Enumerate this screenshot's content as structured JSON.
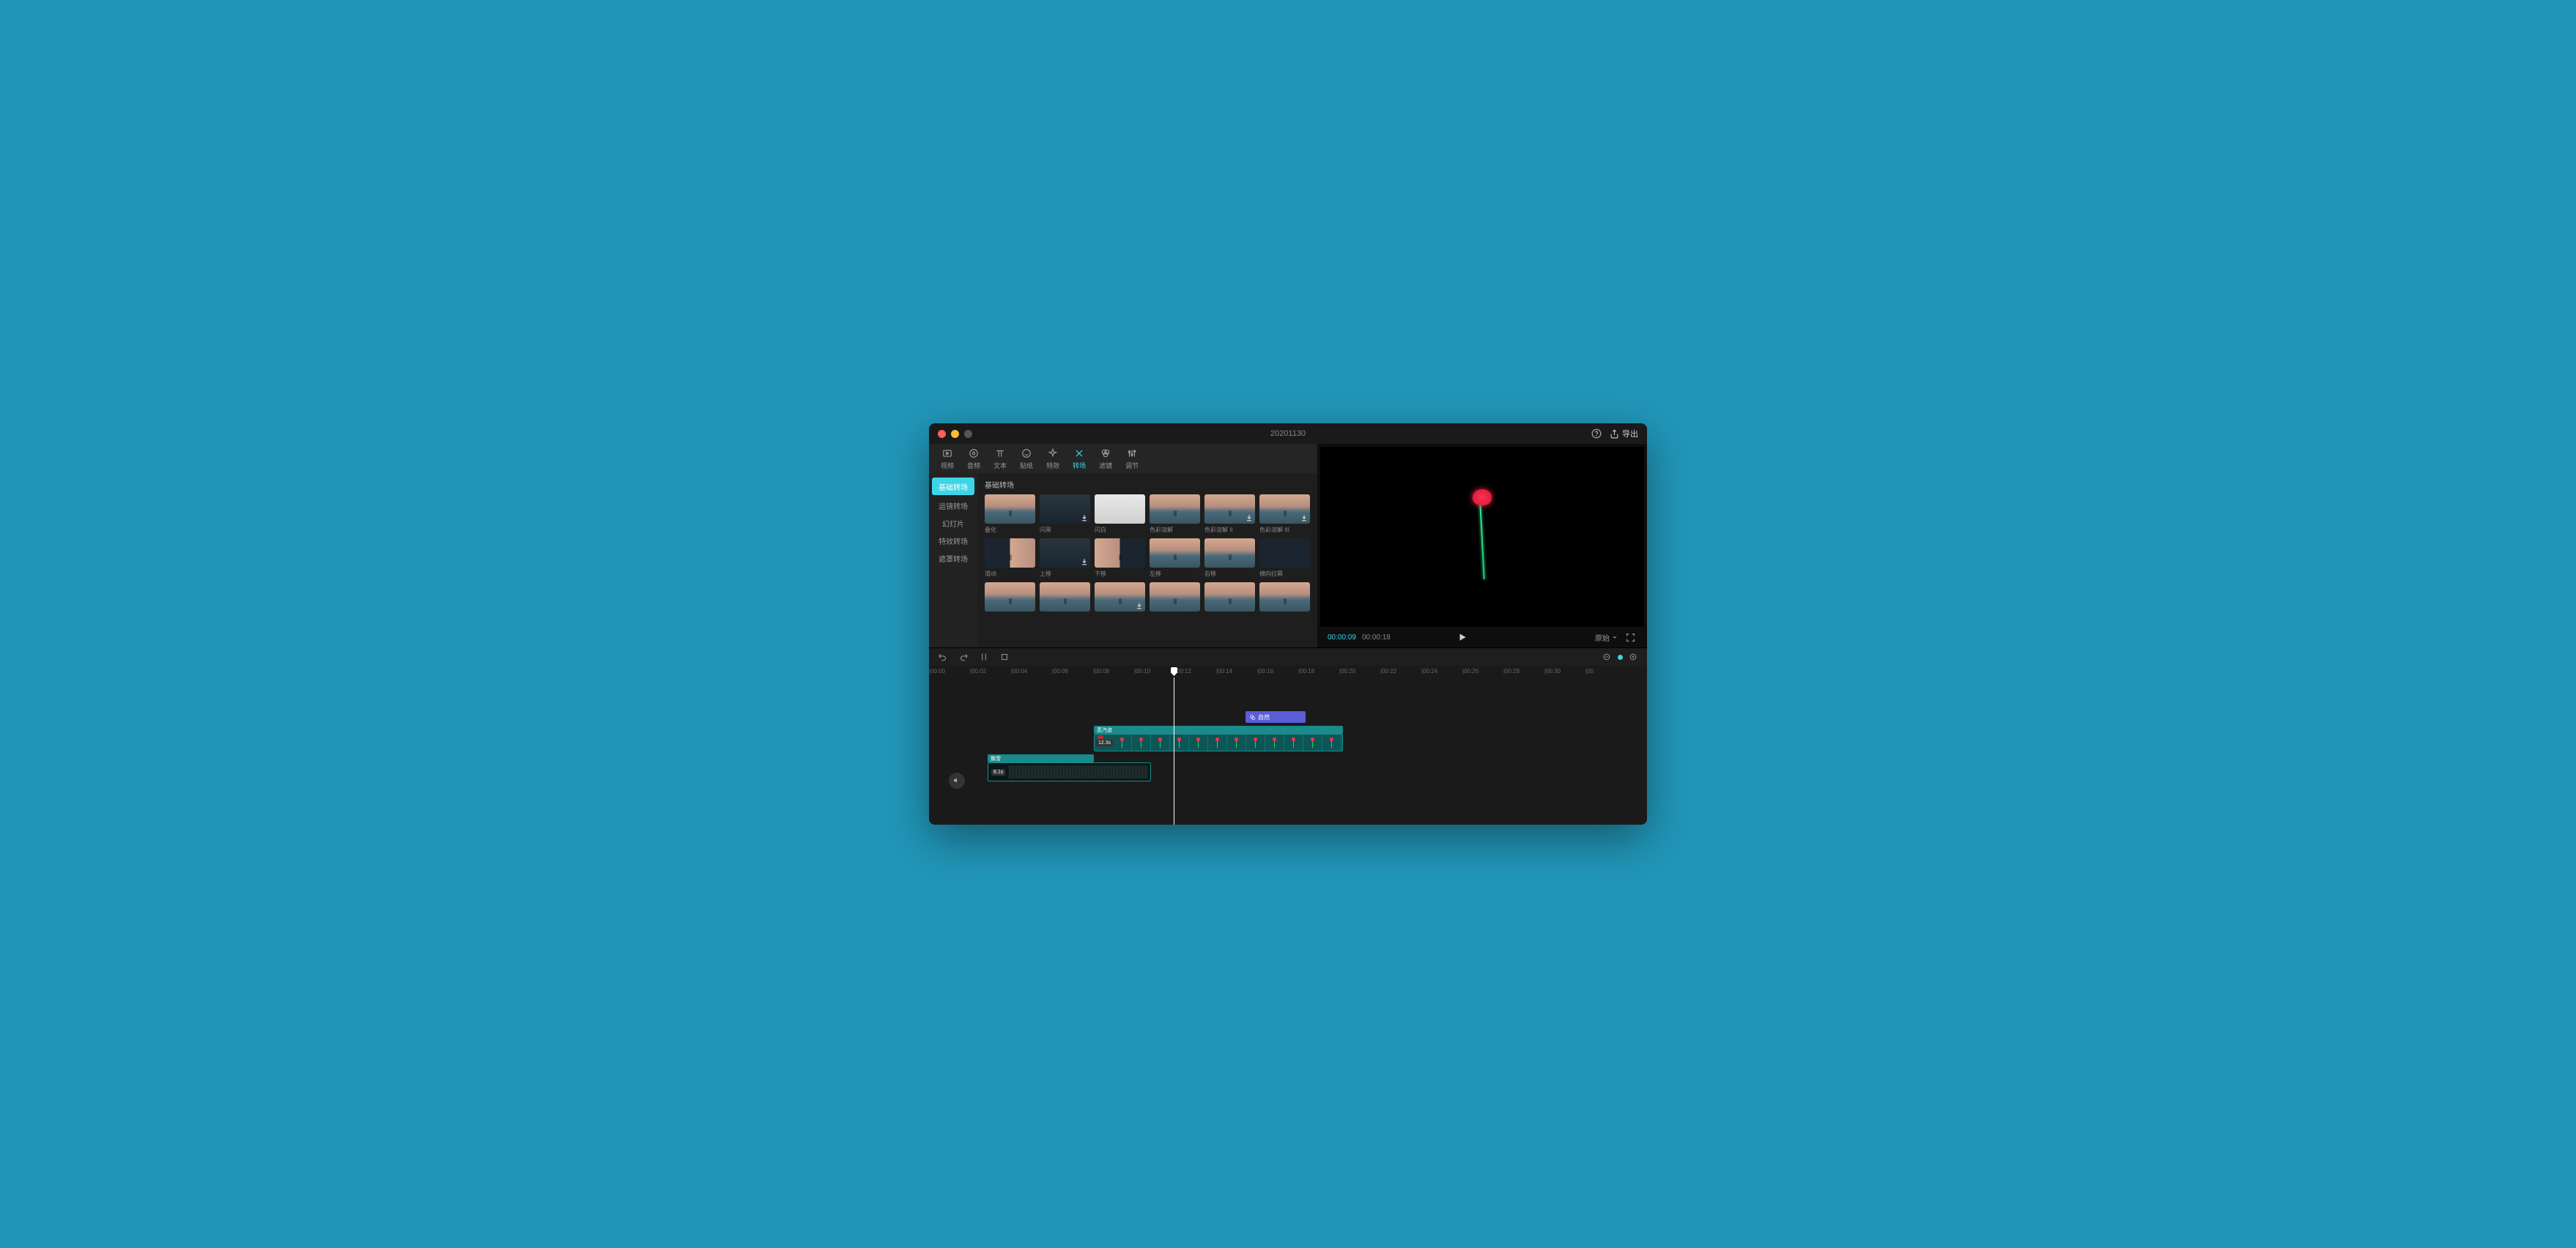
{
  "titlebar": {
    "title": "20201130",
    "export": "导出"
  },
  "tabs": [
    {
      "label": "视频"
    },
    {
      "label": "音频"
    },
    {
      "label": "文本"
    },
    {
      "label": "贴纸"
    },
    {
      "label": "特效"
    },
    {
      "label": "转场"
    },
    {
      "label": "滤镜"
    },
    {
      "label": "调节"
    }
  ],
  "sidebar": [
    {
      "label": "基础转场"
    },
    {
      "label": "运镜转场"
    },
    {
      "label": "幻灯片"
    },
    {
      "label": "特效转场"
    },
    {
      "label": "遮罩转场"
    }
  ],
  "category_title": "基础转场",
  "thumbs": [
    {
      "label": "叠化"
    },
    {
      "label": "闪黑"
    },
    {
      "label": "闪白"
    },
    {
      "label": "色彩溶解"
    },
    {
      "label": "色彩溶解 II"
    },
    {
      "label": "色彩溶解 III"
    },
    {
      "label": "滑动"
    },
    {
      "label": "上移"
    },
    {
      "label": "下移"
    },
    {
      "label": "左移"
    },
    {
      "label": "右移"
    },
    {
      "label": "横向拉幕"
    },
    {
      "label": ""
    },
    {
      "label": ""
    },
    {
      "label": ""
    },
    {
      "label": ""
    },
    {
      "label": ""
    },
    {
      "label": ""
    }
  ],
  "preview": {
    "current": "00:00:09",
    "total": "00:00:18",
    "ratio": "原始"
  },
  "ruler": [
    "|00:00",
    "|00:02",
    "|00:04",
    "|00:06",
    "|00:08",
    "|00:10",
    "|00:12",
    "|00:14",
    "|00:16",
    "|00:18",
    "|00:20",
    "|00:22",
    "|00:24",
    "|00:26",
    "|00:28",
    "|00:30",
    "|00"
  ],
  "clips": {
    "effect_label": "自然",
    "filter_label": "蒸汽波",
    "video_duration": "12.3s",
    "audio_label": "飘雪",
    "audio_duration": "8.1s"
  }
}
